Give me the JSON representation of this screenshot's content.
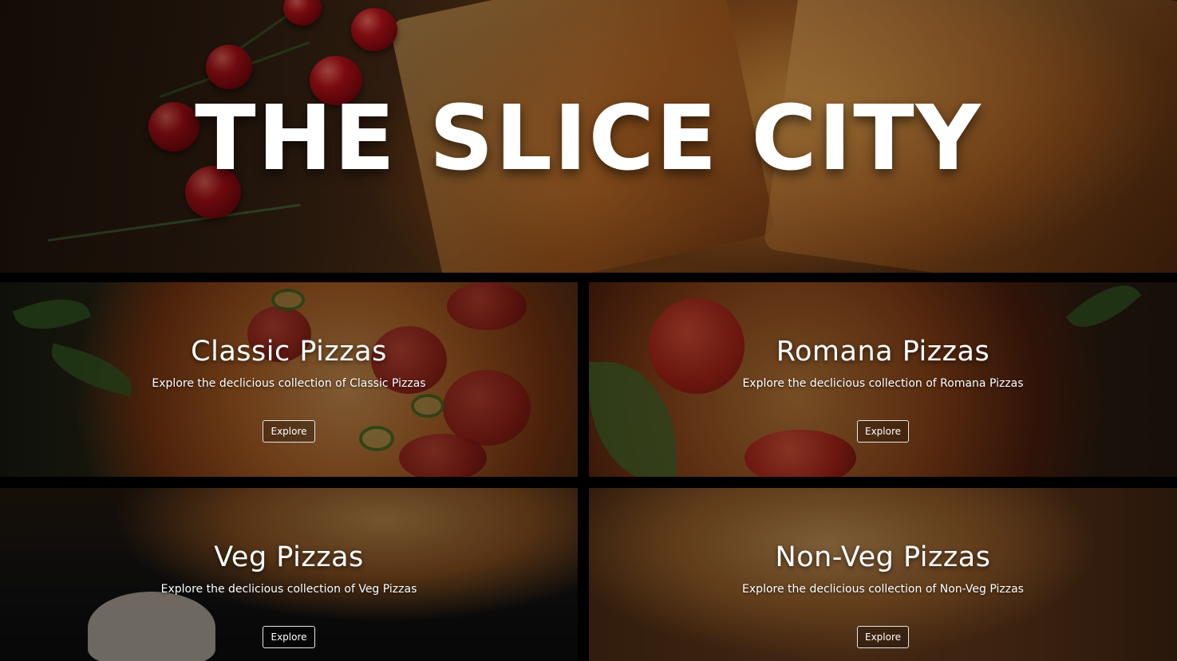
{
  "hero": {
    "title": "THE SLICE CITY"
  },
  "categories": [
    {
      "title": "Classic Pizzas",
      "description": "Explore the declicious collection of Classic Pizzas",
      "button_label": "Explore"
    },
    {
      "title": "Romana Pizzas",
      "description": "Explore the declicious collection of Romana Pizzas",
      "button_label": "Explore"
    },
    {
      "title": "Veg Pizzas",
      "description": "Explore the declicious collection of Veg Pizzas",
      "button_label": "Explore"
    },
    {
      "title": "Non-Veg Pizzas",
      "description": "Explore the declicious collection of Non-Veg Pizzas",
      "button_label": "Explore"
    }
  ],
  "colors": {
    "background": "#000000",
    "text": "#ffffff",
    "button_border": "#e6e6e6"
  }
}
